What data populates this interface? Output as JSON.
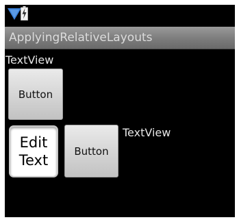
{
  "status_bar": {
    "signal_icon": "signal-icon",
    "battery_icon": "battery-charging-icon"
  },
  "title_bar": {
    "title": "ApplyingRelativeLayouts"
  },
  "text_view_1": "TextView",
  "button_1": "Button",
  "edit_text": {
    "line1": "Edit",
    "line2": "Text"
  },
  "button_2": "Button",
  "text_view_2": "TextView",
  "colors": {
    "screen_bg": "#000000",
    "title_bar": "#8a8a8a",
    "signal": "#3a7fd6"
  }
}
